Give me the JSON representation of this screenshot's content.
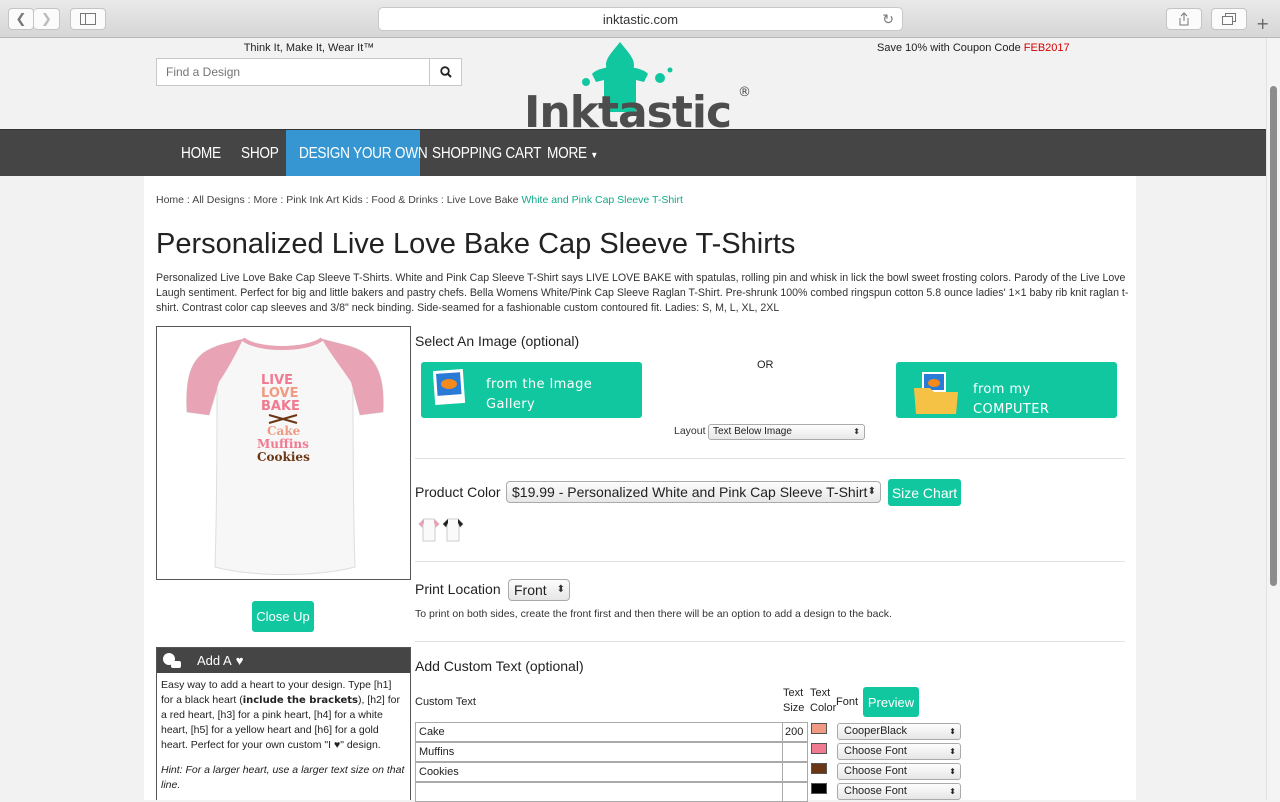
{
  "browser": {
    "url": "inktastic.com"
  },
  "header": {
    "tagline": "Think It, Make It, Wear It™",
    "search_placeholder": "Find a Design",
    "logo_text": "Inktastic",
    "coupon_prefix": "Save 10% with Coupon Code ",
    "coupon_code": "FEB2017"
  },
  "nav": {
    "items": [
      "HOME",
      "SHOP",
      "DESIGN YOUR OWN",
      "SHOPPING CART",
      "MORE"
    ],
    "active": "DESIGN YOUR OWN"
  },
  "breadcrumb": {
    "items": [
      "Home",
      "All Designs",
      "More",
      "Pink Ink Art Kids",
      "Food & Drinks",
      "Live Love Bake"
    ],
    "current": "White and Pink Cap Sleeve T-Shirt",
    "sep": " : "
  },
  "page": {
    "title": "Personalized Live Love Bake Cap Sleeve T-Shirts",
    "description": "Personalized Live Love Bake Cap Sleeve T-Shirts. White and Pink Cap Sleeve T-Shirt says LIVE LOVE BAKE with spatulas, rolling pin and whisk in lick the bowl sweet frosting colors. Parody of the Live Love Laugh sentiment. Perfect for big and little bakers and pastry chefs. Bella Womens White/Pink Cap Sleeve Raglan T-Shirt. Pre-shrunk 100% combed ringspun cotton 5.8 ounce ladies' 1×1 baby rib knit raglan t-shirt. Contrast color cap sleeves and 3/8\" neck binding. Side-seamed for a fashionable custom contoured fit. Ladies: S, M, L, XL, 2XL"
  },
  "product_image": {
    "shirt_lines": [
      "LIVE",
      "LOVE",
      "BAKE",
      "Cake",
      "Muffins",
      "Cookies"
    ],
    "sleeve_color": "#e8a3b5",
    "close_up_label": "Close Up"
  },
  "heart_box": {
    "title": "Add A",
    "body_1": "Easy way to add a heart to your design. Type [h1] for a black heart (",
    "body_bold": "include the brackets",
    "body_2": "), [h2] for a red heart, [h3] for a pink heart, [h4] for a white heart, [h5] for a yellow heart and [h6] for a gold heart. Perfect for your own custom \"I ♥\" design.",
    "hint": "Hint: For a larger heart, use a larger text size on that line."
  },
  "image_section": {
    "label": "Select An Image (optional)",
    "gallery_line1": "from the Image",
    "gallery_line2": "Gallery",
    "or": "OR",
    "computer_line1": "from my",
    "computer_line2": "COMPUTER",
    "layout_label": "Layout",
    "layout_value": "Text Below Image"
  },
  "color_section": {
    "label": "Product Color",
    "selected": "$19.99 - Personalized White and Pink Cap Sleeve T-Shirt",
    "size_chart": "Size Chart",
    "swatches": [
      "pink-white",
      "black-white"
    ]
  },
  "print_section": {
    "label": "Print Location",
    "selected": "Front",
    "note": "To print on both sides, create the front first and then there will be an option to add a design to the back."
  },
  "custom_text": {
    "label": "Add Custom Text (optional)",
    "col_text": "Custom Text",
    "col_size_1": "Text",
    "col_size_2": "Size",
    "col_color_1": "Text",
    "col_color_2": "Color",
    "col_font": "Font",
    "preview": "Preview",
    "rows": [
      {
        "text": "Cake",
        "size": "200",
        "color": "#f09a84",
        "font": "CooperBlack"
      },
      {
        "text": "Muffins",
        "size": "",
        "color": "#f07a90",
        "font": "Choose Font"
      },
      {
        "text": "Cookies",
        "size": "",
        "color": "#6a3614",
        "font": "Choose Font"
      },
      {
        "text": "",
        "size": "",
        "color": "#000000",
        "font": "Choose Font"
      }
    ]
  },
  "colors": {
    "teal": "#11c7a0",
    "nav_bg": "#454545",
    "nav_active": "#3596d2",
    "coupon_red": "#d40000"
  }
}
